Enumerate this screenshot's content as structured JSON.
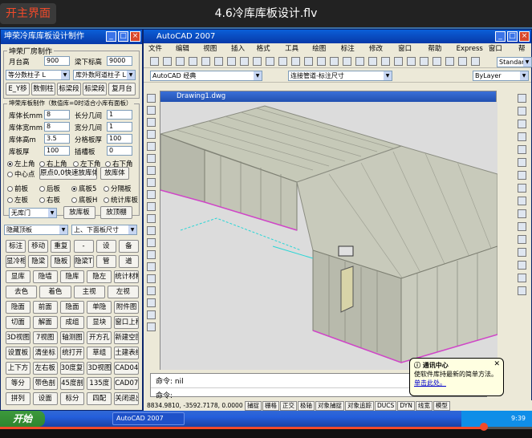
{
  "player": {
    "back_label": "开主界面",
    "video_title": "4.6冷库库板设计.flv",
    "progress": 0.91
  },
  "left_panel": {
    "title": "坤荣冷库库板设计制作",
    "factory_group": "坤荣厂房制作",
    "month_height_label": "月台高",
    "month_height_value": "900",
    "beam_bottom_label": "梁下标高",
    "beam_bottom_value": "9000",
    "select1": "等分数柱子 L",
    "select2": "库外数阿道柱子 L",
    "row_btns": [
      "E_Y移",
      "数侧柱",
      "标梁段",
      "标梁段",
      "复月台"
    ],
    "plate_group": "坤荣库板制作（数值库=0时适合小库有面板）",
    "fields": [
      {
        "label": "库体长mm",
        "value": "8"
      },
      {
        "label": "长分几间",
        "value": "1"
      },
      {
        "label": "库体宽mm",
        "value": "8"
      },
      {
        "label": "宽分几间",
        "value": "1"
      },
      {
        "label": "库体高m",
        "value": "3.5"
      },
      {
        "label": "分格板厚",
        "value": "100"
      },
      {
        "label": "库板厚",
        "value": "100"
      },
      {
        "label": "插槽板",
        "value": "0"
      }
    ],
    "corner_radios": [
      "左上角",
      "右上角",
      "左下角",
      "右下角"
    ],
    "center_radio": "中心点",
    "origin_btn": "原点0,0快速放库体",
    "plate_body_btn": "放库体",
    "radios2": [
      "前板",
      "后板",
      "底板5",
      "分隔板",
      "左板",
      "右板",
      "底板H",
      "统计库板"
    ],
    "door_select": "无库门",
    "door_btn": "放库板",
    "door_btn2": "放顶棚",
    "layer_select": "隐藏顶板",
    "layer_select2": "上、下面板尺寸",
    "grid": [
      [
        "标注",
        "移动",
        "重复",
        "-",
        "设",
        "备"
      ],
      [
        "显冷柜",
        "隐梁",
        "隐板",
        "隐梁T",
        "管",
        "道"
      ],
      [
        "显库",
        "隐墙",
        "隐库",
        "隐左",
        "统计材料"
      ],
      [
        "去色",
        "着色",
        "主视",
        "左视"
      ],
      [
        "隐面",
        "前面",
        "隐面",
        "单隐",
        "附件图"
      ],
      [
        "切面",
        "解面",
        "成组",
        "显块",
        "窗口上移"
      ],
      [
        "3D视图",
        "7视图",
        "轴测图",
        "开方孔",
        "新建空图"
      ],
      [
        "设置板",
        "清坐标",
        "统打开",
        "草组",
        "土建表结库"
      ],
      [
        "上下方",
        "左右板",
        "30度复制",
        "3D视图",
        "CAD04版"
      ],
      [
        "等分",
        "带色剖",
        "45度剖",
        "135度",
        "CAD07版"
      ],
      [
        "拼列",
        "设面",
        "标分",
        "四配",
        "关闭退出"
      ]
    ]
  },
  "autocad": {
    "title": "AutoCAD 2007",
    "menus": [
      "文件(F)",
      "编辑(E)",
      "视图(V)",
      "插入(I)",
      "格式(O)",
      "工具(T)",
      "绘图(D)",
      "标注(N)",
      "修改(M)",
      "窗口(W)",
      "帮助(H)",
      "Express",
      "窗口(W)",
      "帮助"
    ],
    "workspace": "AutoCAD 经典",
    "layer": "连接管道-标注尺寸",
    "bylayer": "ByLayer",
    "style": "Standard",
    "drawing_tab": "Drawing1.dwg",
    "cmd_line1": "命令: nil",
    "cmd_line2": "命令:",
    "coords": "8834.9810,  -3592.7178, 0.0000",
    "status_btns": [
      "捕捉",
      "栅格",
      "正交",
      "极轴",
      "对象捕捉",
      "对象追踪",
      "DUCS",
      "DYN",
      "线宽",
      "模型"
    ]
  },
  "balloon": {
    "title": "通讯中心",
    "text": "使软件库持最新的简单方法。",
    "link": "单击此处。"
  },
  "taskbar": {
    "start": "开始",
    "task": "AutoCAD 2007",
    "time": "9:39"
  }
}
